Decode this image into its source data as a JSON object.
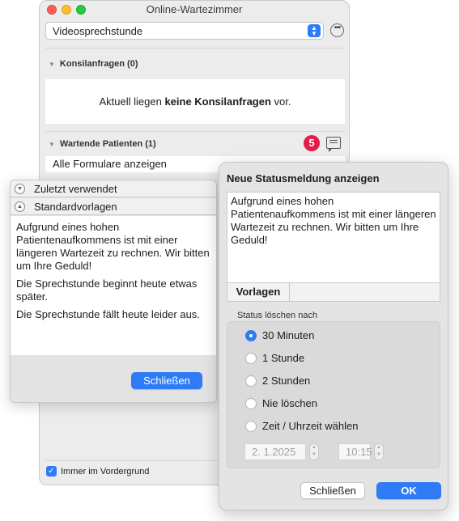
{
  "window": {
    "title": "Online-Wartezimmer"
  },
  "mode_select": {
    "value": "Videosprechstunde"
  },
  "consult": {
    "header": "Konsilanfragen (0)",
    "msg_pre": "Aktuell liegen ",
    "msg_bold": "keine Konsilanfragen",
    "msg_post": " vor."
  },
  "waiting": {
    "header": "Wartende Patienten (1)",
    "badge": "5"
  },
  "forms_filter": {
    "value": "Alle Formulare anzeigen"
  },
  "templates_popover": {
    "recent": "Zuletzt verwendet",
    "standard": "Standardvorlagen",
    "items": [
      "Aufgrund eines hohen Patientenaufkommens ist mit einer längeren Wartezeit zu rechnen. Wir bitten um Ihre Geduld!",
      "Die Sprechstunde beginnt heute etwas später.",
      "Die Sprechstunde fällt heute leider aus."
    ],
    "close": "Schließen"
  },
  "foreground": {
    "label": "Immer im Vordergrund",
    "checked": true
  },
  "status_popover": {
    "title": "Neue Statusmeldung anzeigen",
    "text": "Aufgrund eines hohen Patientenaufkommens ist mit einer längeren Wartezeit zu rechnen. Wir bitten um Ihre Geduld!",
    "templates_button": "Vorlagen",
    "clear_label": "Status löschen nach",
    "options": [
      "30 Minuten",
      "1 Stunde",
      "2 Stunden",
      "Nie löschen",
      "Zeit / Uhrzeit wählen"
    ],
    "selected_option": "30 Minuten",
    "date": "2.  1.2025",
    "time": "10:15",
    "close": "Schließen",
    "ok": "OK"
  },
  "colors": {
    "accent": "#2f7bf5",
    "badge": "#e11d48"
  }
}
